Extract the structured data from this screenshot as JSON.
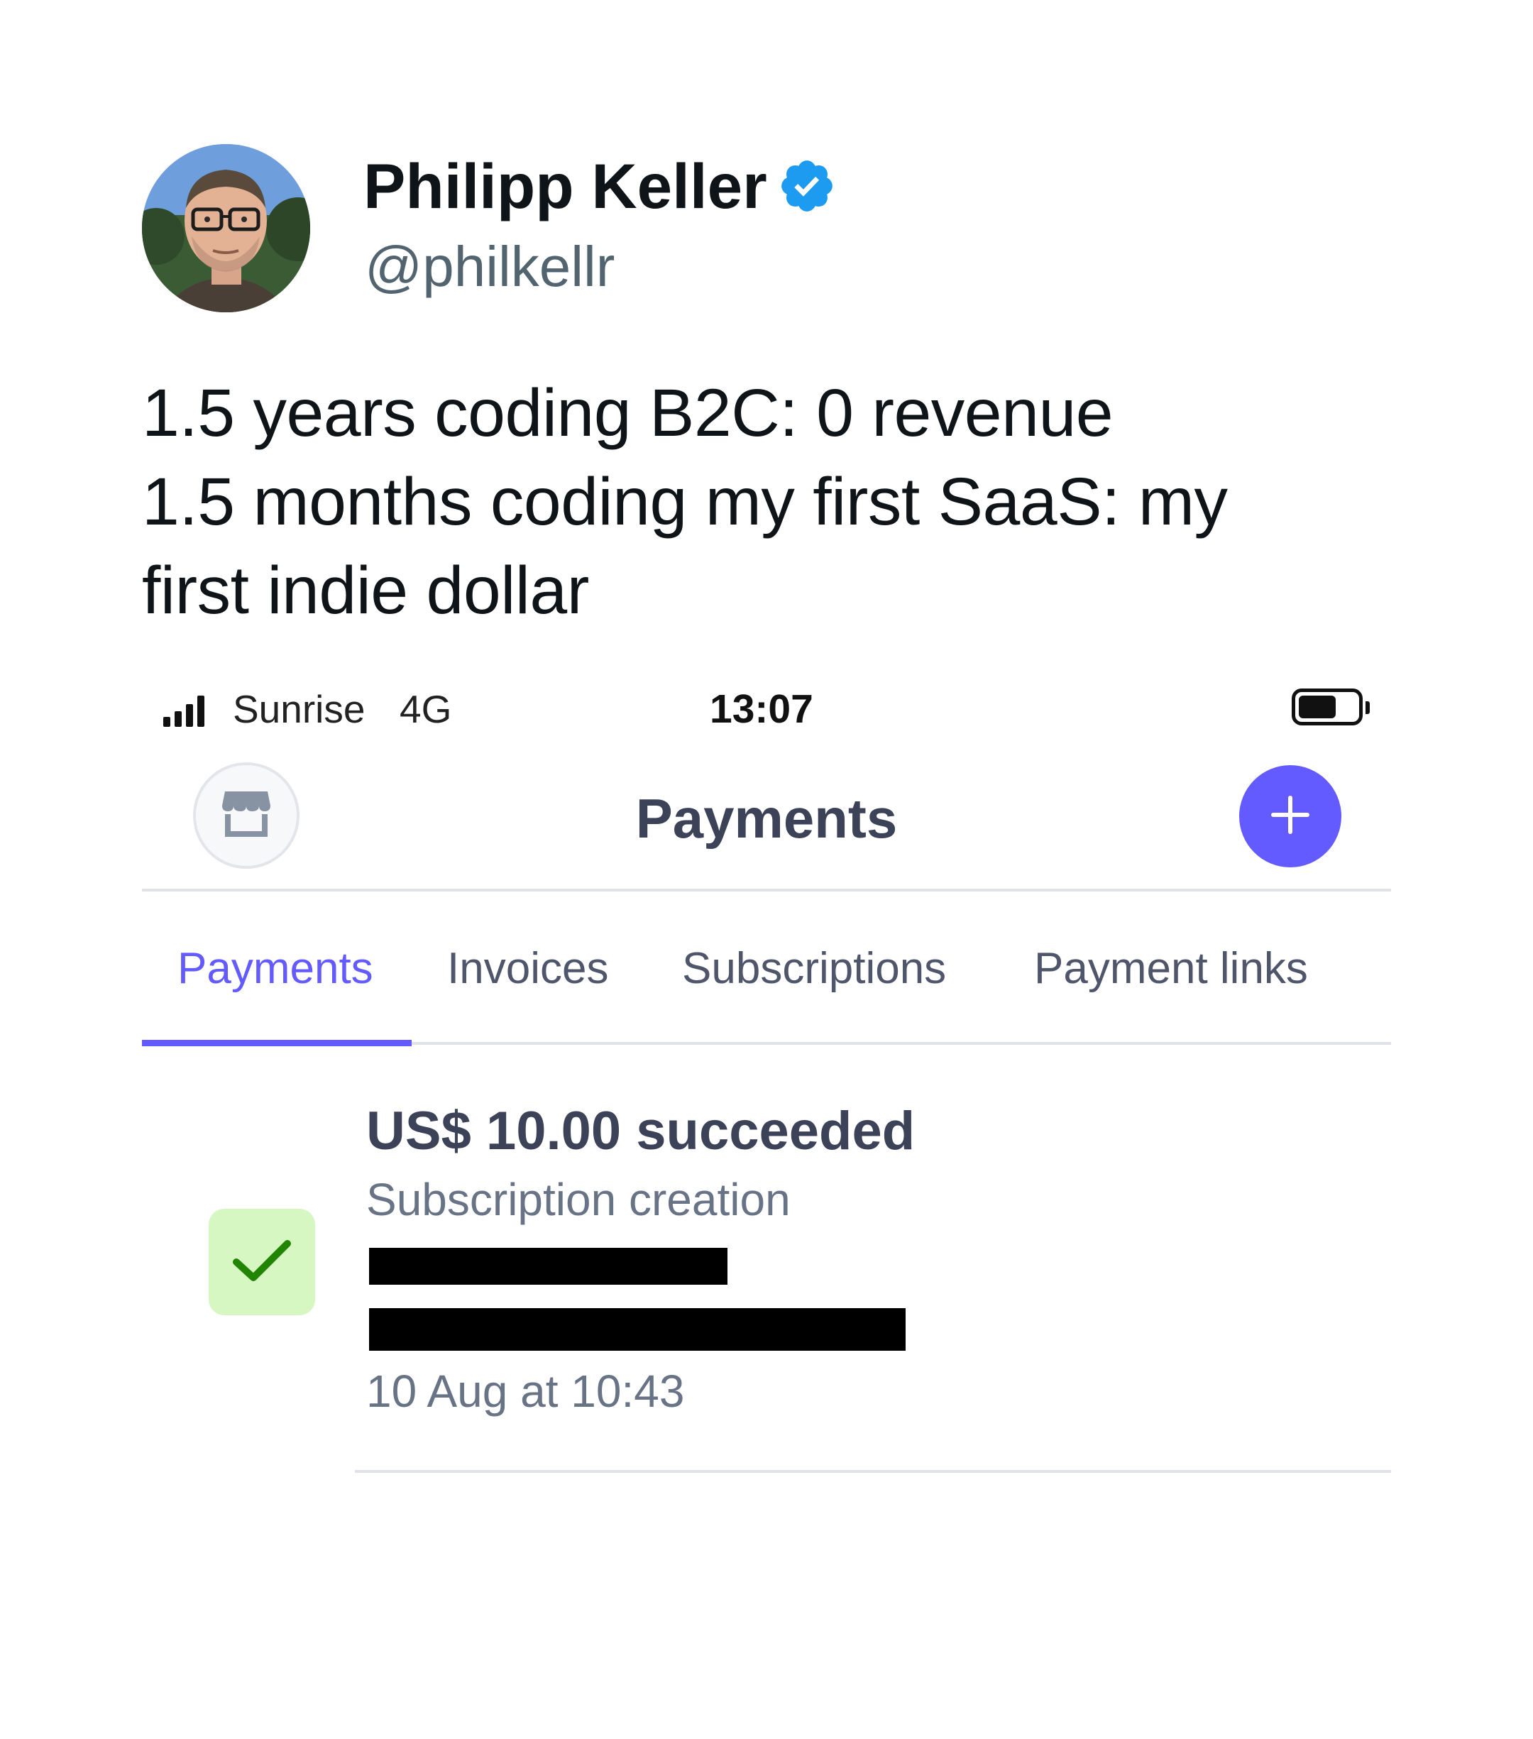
{
  "tweet": {
    "author_name": "Philipp Keller",
    "author_handle": "@philkellr",
    "verified": true,
    "text_lines": [
      "1.5 years coding B2C: 0 revenue",
      "1.5 months coding my first SaaS: my",
      "first indie dollar"
    ]
  },
  "phone": {
    "status_bar": {
      "carrier": "Sunrise",
      "network": "4G",
      "time": "13:07"
    },
    "nav": {
      "title": "Payments",
      "store_icon": "storefront-icon",
      "add_icon": "plus-icon"
    },
    "tabs": [
      {
        "label": "Payments",
        "active": true
      },
      {
        "label": "Invoices",
        "active": false
      },
      {
        "label": "Subscriptions",
        "active": false
      },
      {
        "label": "Payment links",
        "active": false
      }
    ],
    "payment": {
      "amount_status": "US$ 10.00 succeeded",
      "description": "Subscription creation",
      "date": "10 Aug at 10:43",
      "status_icon": "checkmark-icon"
    }
  },
  "colors": {
    "accent": "#635bff",
    "verified_blue": "#1d9bf0",
    "success_bg": "#d7f7c2",
    "success_check": "#228403",
    "muted_text": "#687385",
    "handle_text": "#536471"
  }
}
